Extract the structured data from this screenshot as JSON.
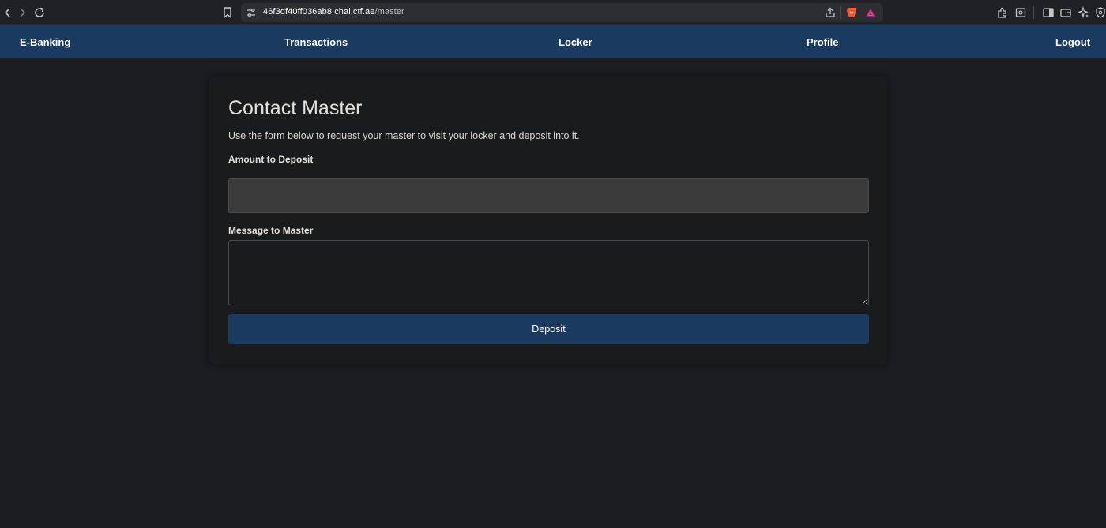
{
  "browser": {
    "url_host": "46f3df40ff036ab8.chal.ctf.ae",
    "url_path": "/master",
    "icons": [
      "back-icon",
      "forward-icon",
      "reload-icon",
      "bookmark-icon",
      "site-info-icon",
      "share-icon",
      "brave-shields-icon",
      "brave-rewards-icon",
      "extensions-icon",
      "reading-mode-icon",
      "sidebar-icon",
      "wallet-icon",
      "leo-ai-icon",
      "vpn-icon"
    ]
  },
  "nav": {
    "brand": "E-Banking",
    "items": [
      {
        "label": "Transactions"
      },
      {
        "label": "Locker"
      },
      {
        "label": "Profile"
      },
      {
        "label": "Logout"
      }
    ],
    "background": "#1b3a5f"
  },
  "form": {
    "title": "Contact Master",
    "description": "Use the form below to request your master to visit your locker and deposit into it.",
    "amount_label": "Amount to Deposit",
    "amount_value": "",
    "message_label": "Message to Master",
    "message_value": "",
    "submit_label": "Deposit"
  },
  "colors": {
    "accent": "#1b3a5f",
    "page_bg": "#1c1d20",
    "card_bg": "#1a1b1d"
  }
}
